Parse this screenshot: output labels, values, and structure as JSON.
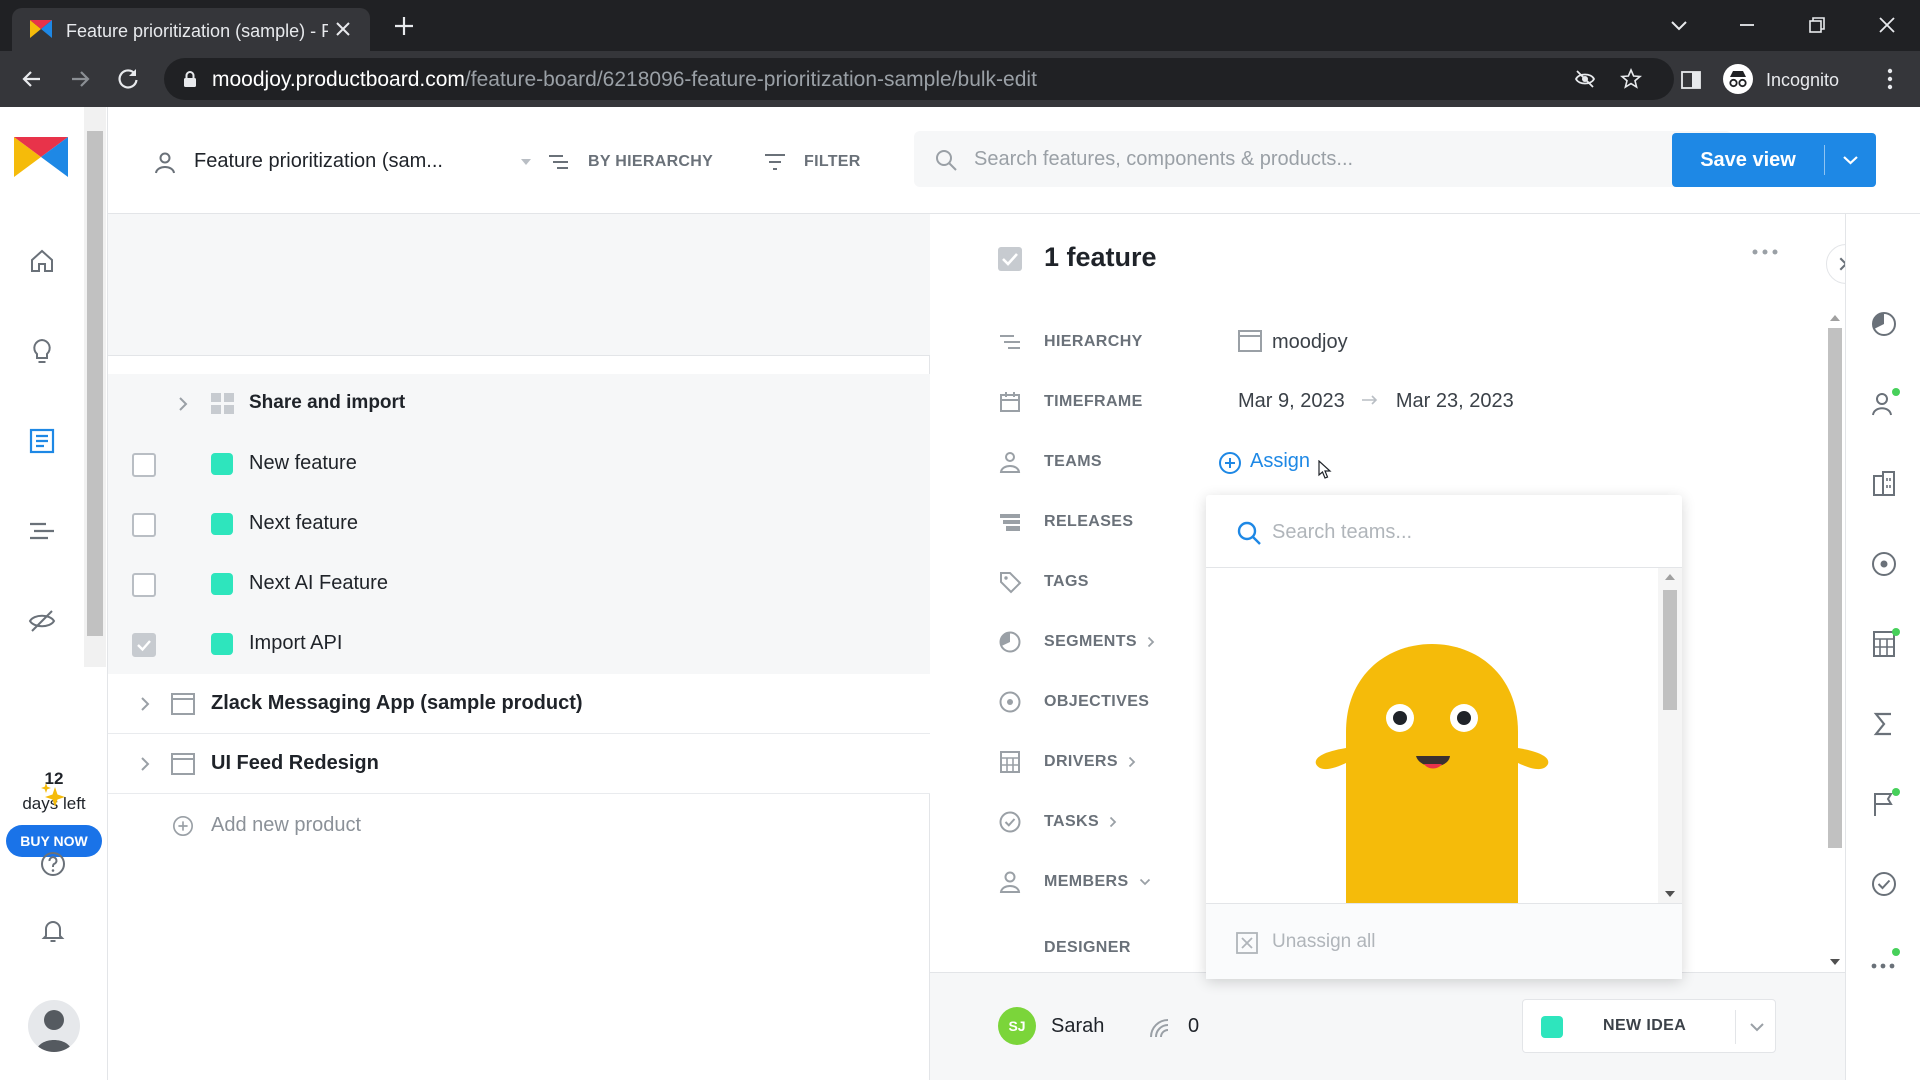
{
  "browser": {
    "tab_title": "Feature prioritization (sample) - Productboard",
    "url_host": "moodjoy.productboard.com",
    "url_path": "/feature-board/6218096-feature-prioritization-sample/bulk-edit",
    "profile_label": "Incognito"
  },
  "leftnav": {
    "trial_days": "12",
    "trial_label": "days left",
    "buy_now_label": "BUY NOW"
  },
  "toolbar": {
    "board_name": "Feature prioritization (sam...",
    "group_by_label": "BY HIERARCHY",
    "filter_label": "FILTER",
    "search_placeholder": "Search features, components & products...",
    "save_view_label": "Save view"
  },
  "list": {
    "rows": [
      {
        "kind": "component",
        "label": "Share and import"
      },
      {
        "kind": "feature",
        "label": "New feature",
        "checked": false,
        "color": "#2ee5bd"
      },
      {
        "kind": "feature",
        "label": "Next feature",
        "checked": false,
        "color": "#2ee5bd"
      },
      {
        "kind": "feature",
        "label": "Next AI Feature",
        "checked": false,
        "color": "#2ee5bd"
      },
      {
        "kind": "feature",
        "label": "Import API",
        "checked": true,
        "color": "#2ee5bd"
      },
      {
        "kind": "product",
        "label": "Zlack Messaging App (sample product)"
      },
      {
        "kind": "product",
        "label": "UI Feed Redesign"
      },
      {
        "kind": "add",
        "label": "Add new product"
      }
    ]
  },
  "detail": {
    "title": "1 feature",
    "fields": {
      "hierarchy": {
        "label": "HIERARCHY",
        "value": "moodjoy"
      },
      "timeframe": {
        "label": "TIMEFRAME",
        "start": "Mar 9, 2023",
        "end": "Mar 23, 2023"
      },
      "teams": {
        "label": "TEAMS",
        "assign_label": "Assign"
      },
      "releases": {
        "label": "RELEASES"
      },
      "tags": {
        "label": "TAGS"
      },
      "segments": {
        "label": "SEGMENTS"
      },
      "objectives": {
        "label": "OBJECTIVES"
      },
      "drivers": {
        "label": "DRIVERS"
      },
      "tasks": {
        "label": "TASKS"
      },
      "members": {
        "label": "MEMBERS"
      },
      "designer": {
        "label": "DESIGNER"
      }
    },
    "footer": {
      "owner_initials": "SJ",
      "owner_name": "Sarah",
      "insights_count": "0",
      "status_label": "NEW IDEA",
      "status_color": "#2ee5bd"
    }
  },
  "teams_dropdown": {
    "search_placeholder": "Search teams...",
    "unassign_label": "Unassign all"
  },
  "colors": {
    "accent": "#1e88e5",
    "feature_teal": "#2ee5bd",
    "ghost_yellow": "#f5bb0a",
    "notification_green": "#47d05a"
  }
}
